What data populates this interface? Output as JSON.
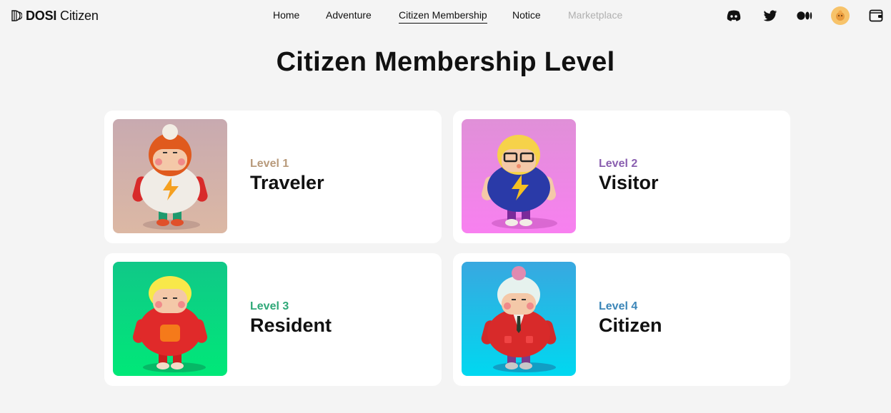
{
  "brand": {
    "logo_bold": "DOSI",
    "logo_light": "Citizen"
  },
  "nav": {
    "home": "Home",
    "adventure": "Adventure",
    "membership": "Citizen Membership",
    "notice": "Notice",
    "marketplace": "Marketplace"
  },
  "header_icons": [
    "discord-icon",
    "twitter-icon",
    "medium-icon",
    "profile-avatar",
    "wallet-icon"
  ],
  "page_title": "Citizen Membership Level",
  "levels": [
    {
      "level": "Level 1",
      "name": "Traveler",
      "color": "#b89a7b"
    },
    {
      "level": "Level 2",
      "name": "Visitor",
      "color": "#8a5fb0"
    },
    {
      "level": "Level 3",
      "name": "Resident",
      "color": "#2fa878"
    },
    {
      "level": "Level 4",
      "name": "Citizen",
      "color": "#3b86b8"
    }
  ]
}
